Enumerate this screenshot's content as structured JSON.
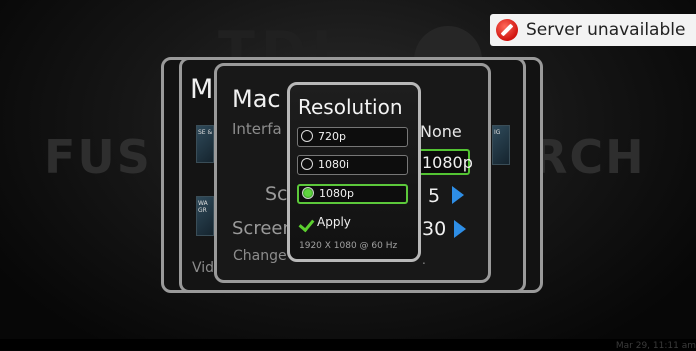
{
  "background": {
    "logo_text": "TDI",
    "left_word": "FUS",
    "right_word": "RCH",
    "clock": "Mar 29, 11:11 am"
  },
  "server_status": {
    "icon": "error-icon",
    "text": "Server unavailable",
    "color": "#d0140f"
  },
  "back_dialogs": {
    "title_partial": "M",
    "vid_partial": "Vid",
    "thumb1": "SE\n&",
    "thumb2": "WA\nGR",
    "thumb3": "IG"
  },
  "machine_dialog": {
    "title_partial": "Mac",
    "interface_partial": "Interfa",
    "interface_value": "None",
    "resolution_value": "1080p",
    "sc_partial": "Sc",
    "sc_value": "5",
    "screen_partial": "Screen",
    "screen_value": "30",
    "change_partial": "Change",
    "trailing_dot": ".",
    "accent": "#53c433",
    "arrow_color": "#2e8ee6"
  },
  "resolution_dialog": {
    "title": "Resolution",
    "options": [
      {
        "label": "720p",
        "selected": false
      },
      {
        "label": "1080i",
        "selected": false
      },
      {
        "label": "1080p",
        "selected": true
      }
    ],
    "apply_label": "Apply",
    "info": "1920 X 1080 @ 60 Hz"
  }
}
